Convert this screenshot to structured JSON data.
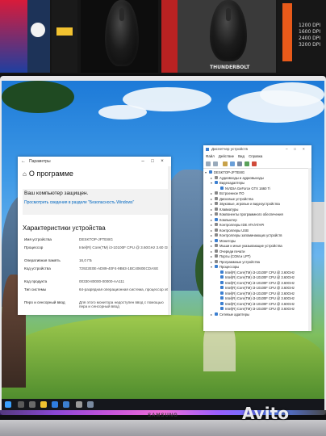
{
  "settings_window": {
    "title": "Параметры",
    "heading": "О программе",
    "protection_title": "Ваш компьютер защищен.",
    "protection_link": "Просмотреть сведения в разделе \"Безопасность Windows\"",
    "specs_heading": "Характеристики устройства",
    "specs": [
      {
        "key": "Имя устройства",
        "value": "DESKTOP-JFTE8IG"
      },
      {
        "key": "Процессор",
        "value": "Intel(R) Core(TM) i3-10100F CPU @ 3.60GHz   3.60 GHz"
      },
      {
        "key": "Оперативная память",
        "value": "16,0 ГБ"
      },
      {
        "key": "Код устройства",
        "value": "72922E0E-AD89-40F4-9B63-1BC4060ECDASE"
      },
      {
        "key": "Код продукта",
        "value": "00330-80000-00000-AA111"
      },
      {
        "key": "Тип системы",
        "value": "64-разрядная операционная система, процессор x64"
      },
      {
        "key": "Перо и сенсорный ввод",
        "value": "Для этого монитора недоступен ввод с помощью пера и сенсорный ввод"
      }
    ]
  },
  "device_manager": {
    "title": "Диспетчер устройств",
    "menu": [
      "Файл",
      "Действие",
      "Вид",
      "Справка"
    ],
    "tree": [
      {
        "label": "DESKTOP-JFTE8IG",
        "level": 0,
        "expanded": true,
        "icon_color": "#3c7fd0"
      },
      {
        "label": "Аудиовходы и аудиовыходы",
        "level": 1,
        "expanded": false,
        "icon_color": "#888888"
      },
      {
        "label": "Видеоадаптеры",
        "level": 1,
        "expanded": true,
        "icon_color": "#3c7fd0"
      },
      {
        "label": "NVIDIA GeForce GTX 1660 Ti",
        "level": 2,
        "expanded": null,
        "icon_color": "#3c7fd0"
      },
      {
        "label": "Встроенное ПО",
        "level": 1,
        "expanded": false,
        "icon_color": "#888888"
      },
      {
        "label": "Дисковые устройства",
        "level": 1,
        "expanded": false,
        "icon_color": "#888888"
      },
      {
        "label": "Звуковые, игровые и видеоустройства",
        "level": 1,
        "expanded": false,
        "icon_color": "#888888"
      },
      {
        "label": "Клавиатуры",
        "level": 1,
        "expanded": false,
        "icon_color": "#888888"
      },
      {
        "label": "Компоненты программного обеспечения",
        "level": 1,
        "expanded": false,
        "icon_color": "#888888"
      },
      {
        "label": "Компьютер",
        "level": 1,
        "expanded": false,
        "icon_color": "#3c7fd0"
      },
      {
        "label": "Контроллеры IDE ATA/ATAPI",
        "level": 1,
        "expanded": false,
        "icon_color": "#888888"
      },
      {
        "label": "Контроллеры USB",
        "level": 1,
        "expanded": false,
        "icon_color": "#888888"
      },
      {
        "label": "Контроллеры запоминающих устройств",
        "level": 1,
        "expanded": false,
        "icon_color": "#888888"
      },
      {
        "label": "Мониторы",
        "level": 1,
        "expanded": false,
        "icon_color": "#3c7fd0"
      },
      {
        "label": "Мыши и иные указывающие устройства",
        "level": 1,
        "expanded": false,
        "icon_color": "#888888"
      },
      {
        "label": "Очереди печати",
        "level": 1,
        "expanded": false,
        "icon_color": "#888888"
      },
      {
        "label": "Порты (COM и LPT)",
        "level": 1,
        "expanded": false,
        "icon_color": "#888888"
      },
      {
        "label": "Программные устройства",
        "level": 1,
        "expanded": false,
        "icon_color": "#888888"
      },
      {
        "label": "Процессоры",
        "level": 1,
        "expanded": true,
        "icon_color": "#3c7fd0"
      },
      {
        "label": "Intel(R) Core(TM) i3-10100F CPU @ 3.60GHz",
        "level": 2,
        "expanded": null,
        "icon_color": "#3c7fd0"
      },
      {
        "label": "Intel(R) Core(TM) i3-10100F CPU @ 3.60GHz",
        "level": 2,
        "expanded": null,
        "icon_color": "#3c7fd0"
      },
      {
        "label": "Intel(R) Core(TM) i3-10100F CPU @ 3.60GHz",
        "level": 2,
        "expanded": null,
        "icon_color": "#3c7fd0"
      },
      {
        "label": "Intel(R) Core(TM) i3-10100F CPU @ 3.60GHz",
        "level": 2,
        "expanded": null,
        "icon_color": "#3c7fd0"
      },
      {
        "label": "Intel(R) Core(TM) i3-10100F CPU @ 3.60GHz",
        "level": 2,
        "expanded": null,
        "icon_color": "#3c7fd0"
      },
      {
        "label": "Intel(R) Core(TM) i3-10100F CPU @ 3.60GHz",
        "level": 2,
        "expanded": null,
        "icon_color": "#3c7fd0"
      },
      {
        "label": "Intel(R) Core(TM) i3-10100F CPU @ 3.60GHz",
        "level": 2,
        "expanded": null,
        "icon_color": "#3c7fd0"
      },
      {
        "label": "Intel(R) Core(TM) i3-10100F CPU @ 3.60GHz",
        "level": 2,
        "expanded": null,
        "icon_color": "#3c7fd0"
      },
      {
        "label": "Сетевые адаптеры",
        "level": 1,
        "expanded": false,
        "icon_color": "#3c7fd0"
      }
    ]
  },
  "shelf": {
    "box_label": "THUNDERBOLT",
    "box_specs": [
      "1200 DPI",
      "1600 DPI",
      "2400 DPI",
      "3200 DPI"
    ]
  },
  "monitor": {
    "brand": "SAMSUNG"
  },
  "watermark": "Avito",
  "colors": {
    "link": "#0067c0",
    "accent": "#3c7fd0",
    "rgb_strip": "#c03ad8"
  }
}
